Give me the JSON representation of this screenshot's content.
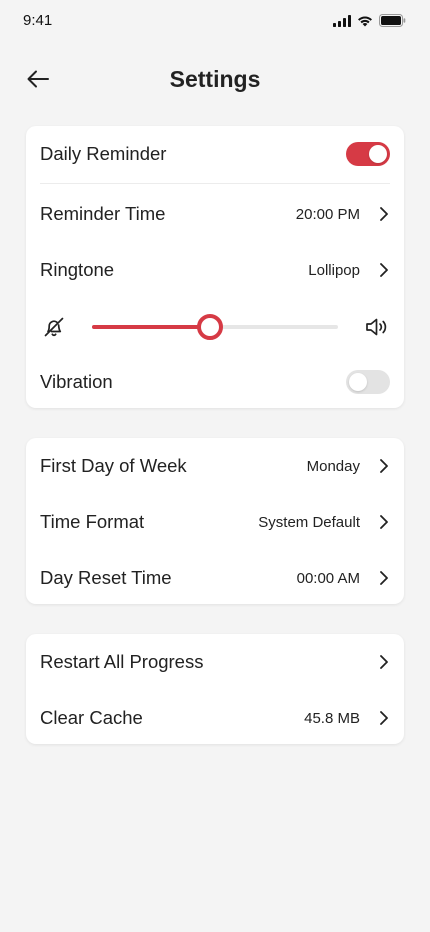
{
  "status_bar": {
    "time": "9:41"
  },
  "header": {
    "title": "Settings"
  },
  "colors": {
    "accent": "#d63a45",
    "background": "#f4f4f4",
    "card": "#ffffff"
  },
  "card1": {
    "daily_reminder": {
      "label": "Daily Reminder",
      "enabled": true
    },
    "reminder_time": {
      "label": "Reminder Time",
      "value": "20:00 PM"
    },
    "ringtone": {
      "label": "Ringtone",
      "value": "Lollipop"
    },
    "volume": {
      "level": 0.48,
      "min_icon": "bell-off-icon",
      "max_icon": "speaker-loud-icon"
    },
    "vibration": {
      "label": "Vibration",
      "enabled": false
    }
  },
  "card2": {
    "first_day": {
      "label": "First Day of Week",
      "value": "Monday"
    },
    "time_format": {
      "label": "Time Format",
      "value": "System Default"
    },
    "day_reset": {
      "label": "Day Reset Time",
      "value": "00:00 AM"
    }
  },
  "card3": {
    "restart": {
      "label": "Restart All Progress"
    },
    "clear_cache": {
      "label": "Clear Cache",
      "value": "45.8 MB"
    }
  }
}
